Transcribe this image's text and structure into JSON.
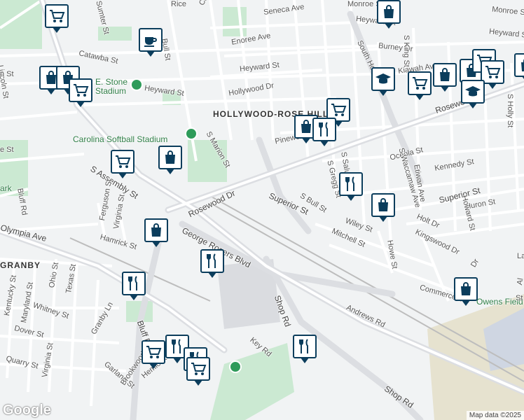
{
  "map": {
    "street_labels": [
      {
        "text": "Rice",
        "id": "rice"
      },
      {
        "text": "Catawba St",
        "id": "catawba-st-top"
      },
      {
        "text": "Seneca Ave",
        "id": "seneca"
      },
      {
        "text": "Monroe St",
        "id": "monroe-1"
      },
      {
        "text": "Monroe St",
        "id": "monroe-2"
      },
      {
        "text": "Heyward St",
        "id": "heyward-1"
      },
      {
        "text": "Heyward St",
        "id": "heyward-2"
      },
      {
        "text": "Heyward St",
        "id": "heyward-3"
      },
      {
        "text": "Heyward St",
        "id": "heyward-4"
      },
      {
        "text": "Burney Dr",
        "id": "burney"
      },
      {
        "text": "S King St",
        "id": "king"
      },
      {
        "text": "South Holly St",
        "id": "south-holly"
      },
      {
        "text": "S Holly St",
        "id": "s-holly"
      },
      {
        "text": "Kiawah Ave",
        "id": "kiawah"
      },
      {
        "text": "Enoree Ave",
        "id": "enoree"
      },
      {
        "text": "Catawba St",
        "id": "catawba-st-left"
      },
      {
        "text": "Bull St",
        "id": "bull-1"
      },
      {
        "text": "Sumter St",
        "id": "sumter"
      },
      {
        "text": "Lincoln St",
        "id": "lincoln"
      },
      {
        "text": "Hollywood Dr",
        "id": "hollywood"
      },
      {
        "text": "Pinewood Dr",
        "id": "pinewood"
      },
      {
        "text": "S Marion St",
        "id": "marion"
      },
      {
        "text": "Oceola St",
        "id": "oceola"
      },
      {
        "text": "Kennedy St",
        "id": "kennedy"
      },
      {
        "text": "S Gregg St",
        "id": "gregg"
      },
      {
        "text": "S Saluda St",
        "id": "saluda"
      },
      {
        "text": "S Waccamaw Ave",
        "id": "waccamaw"
      },
      {
        "text": "Etiwan Ave",
        "id": "etiwan"
      },
      {
        "text": "Superior St",
        "id": "superior-1"
      },
      {
        "text": "Superior St",
        "id": "superior-2"
      },
      {
        "text": "Huron St",
        "id": "huron"
      },
      {
        "text": "Howard St",
        "id": "howard"
      },
      {
        "text": "Rosewood Dr",
        "id": "rosewood-1"
      },
      {
        "text": "Rosewood Dr",
        "id": "rosewood-2"
      },
      {
        "text": "S Assembly St",
        "id": "assembly"
      },
      {
        "text": "S Bull St",
        "id": "s-bull"
      },
      {
        "text": "Wiley St",
        "id": "wiley"
      },
      {
        "text": "Holt Dr",
        "id": "holt"
      },
      {
        "text": "Mitchell St",
        "id": "mitchell"
      },
      {
        "text": "Kingswood Dr",
        "id": "kingswood"
      },
      {
        "text": "Howe St",
        "id": "howe"
      },
      {
        "text": "Commerce Dr",
        "id": "commerce"
      },
      {
        "text": "Bluff Rd",
        "id": "bluff-1"
      },
      {
        "text": "Bluff Rd",
        "id": "bluff-2"
      },
      {
        "text": "Ferguson St",
        "id": "ferguson"
      },
      {
        "text": "Virginia St",
        "id": "virginia-1"
      },
      {
        "text": "Virginia St",
        "id": "virginia-2"
      },
      {
        "text": "Hamrick St",
        "id": "hamrick"
      },
      {
        "text": "George Rogers Blvd",
        "id": "george-rogers"
      },
      {
        "text": "Olympia Ave",
        "id": "olympia"
      },
      {
        "text": "Ohio St",
        "id": "ohio"
      },
      {
        "text": "Texas St",
        "id": "texas"
      },
      {
        "text": "Kentucky St",
        "id": "kentucky"
      },
      {
        "text": "Maryland St",
        "id": "maryland"
      },
      {
        "text": "Whitney St",
        "id": "whitney"
      },
      {
        "text": "Dover St",
        "id": "dover"
      },
      {
        "text": "Quarry St",
        "id": "quarry"
      },
      {
        "text": "Granby Ln",
        "id": "granby-ln"
      },
      {
        "text": "Shop Rd",
        "id": "shop-1"
      },
      {
        "text": "Shop Rd",
        "id": "shop-2"
      },
      {
        "text": "Andrews Rd",
        "id": "andrews"
      },
      {
        "text": "Key Rd",
        "id": "key"
      },
      {
        "text": "Hemlock Rd",
        "id": "hemlock"
      },
      {
        "text": "Garland St",
        "id": "garland"
      },
      {
        "text": "Brookwood Dr",
        "id": "brookwood"
      },
      {
        "text": "St",
        "id": "st-right"
      },
      {
        "text": "Al",
        "id": "al-right"
      },
      {
        "text": "Lau",
        "id": "lau-right"
      },
      {
        "text": "Dr",
        "id": "dr-right"
      },
      {
        "text": "n St",
        "id": "n-st-left"
      },
      {
        "text": "e St",
        "id": "e-st-left"
      }
    ],
    "place_labels": {
      "stone_stadium_1": "E. Stone",
      "stone_stadium_2": "Stadium",
      "softball": "Carolina Softball Stadium",
      "hollywood_rose_hill": "HOLLYWOOD-ROSE HILL",
      "granby": "GRANBY",
      "park_left": "ark",
      "owens_field": "Owens Field S"
    },
    "pins": [
      {
        "id": "shopping-cart-1",
        "icon": "shopping-cart"
      },
      {
        "id": "coffee-1",
        "icon": "coffee-cup"
      }
    ],
    "attribution": "Map data ©2025",
    "logo": "Google"
  }
}
